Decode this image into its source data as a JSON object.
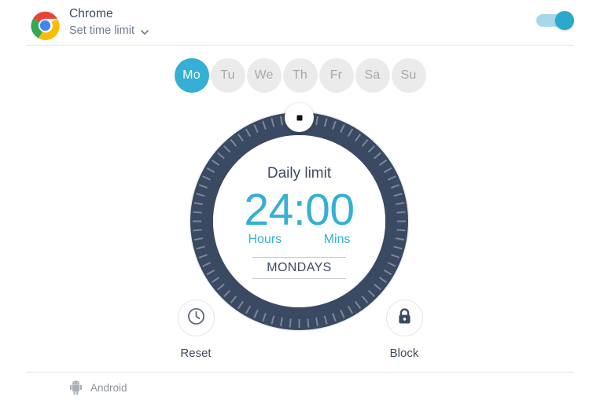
{
  "header": {
    "app_name": "Chrome",
    "subtitle": "Set time limit",
    "logo_icon": "chrome-logo-icon",
    "chevron_icon": "chevron-down-icon",
    "toggle": {
      "name": "time-limit-toggle",
      "state": "on",
      "track_color": "#a5d9ea",
      "knob_color": "#2ca8cd"
    }
  },
  "days": {
    "selected": "Mo",
    "selected_color": "#35b0d4",
    "unselected_color": "#ebebeb",
    "items": [
      {
        "label": "Mo",
        "selected": true
      },
      {
        "label": "Tu",
        "selected": false
      },
      {
        "label": "We",
        "selected": false
      },
      {
        "label": "Th",
        "selected": false
      },
      {
        "label": "Fr",
        "selected": false
      },
      {
        "label": "Sa",
        "selected": false
      },
      {
        "label": "Su",
        "selected": false
      }
    ]
  },
  "dial": {
    "title": "Daily limit",
    "time": "24:00",
    "hours_label": "Hours",
    "mins_label": "Mins",
    "day_scope": "MONDAYS",
    "ring_color": "#3b4a63",
    "tick_color": "#7e8799",
    "accent_color": "#35b0d4",
    "knob_name": "dial-knob"
  },
  "actions": [
    {
      "label": "Reset",
      "icon": "clock-icon",
      "name": "reset-button"
    },
    {
      "label": "Block",
      "icon": "lock-icon",
      "name": "block-button"
    }
  ],
  "footer": {
    "platform": "Android",
    "icon": "android-icon"
  }
}
